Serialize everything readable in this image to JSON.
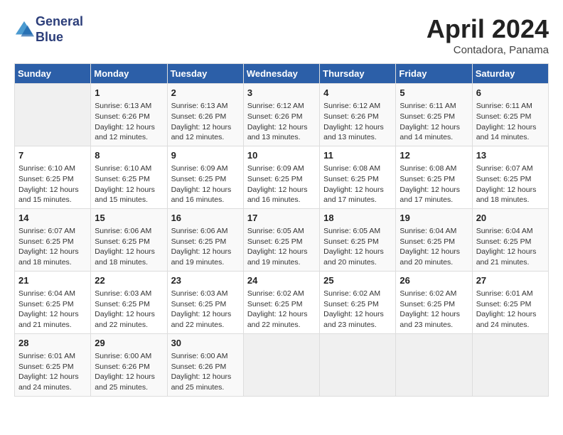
{
  "logo": {
    "line1": "General",
    "line2": "Blue"
  },
  "title": "April 2024",
  "subtitle": "Contadora, Panama",
  "days_header": [
    "Sunday",
    "Monday",
    "Tuesday",
    "Wednesday",
    "Thursday",
    "Friday",
    "Saturday"
  ],
  "weeks": [
    [
      {
        "num": "",
        "info": ""
      },
      {
        "num": "1",
        "info": "Sunrise: 6:13 AM\nSunset: 6:26 PM\nDaylight: 12 hours\nand 12 minutes."
      },
      {
        "num": "2",
        "info": "Sunrise: 6:13 AM\nSunset: 6:26 PM\nDaylight: 12 hours\nand 12 minutes."
      },
      {
        "num": "3",
        "info": "Sunrise: 6:12 AM\nSunset: 6:26 PM\nDaylight: 12 hours\nand 13 minutes."
      },
      {
        "num": "4",
        "info": "Sunrise: 6:12 AM\nSunset: 6:26 PM\nDaylight: 12 hours\nand 13 minutes."
      },
      {
        "num": "5",
        "info": "Sunrise: 6:11 AM\nSunset: 6:25 PM\nDaylight: 12 hours\nand 14 minutes."
      },
      {
        "num": "6",
        "info": "Sunrise: 6:11 AM\nSunset: 6:25 PM\nDaylight: 12 hours\nand 14 minutes."
      }
    ],
    [
      {
        "num": "7",
        "info": "Sunrise: 6:10 AM\nSunset: 6:25 PM\nDaylight: 12 hours\nand 15 minutes."
      },
      {
        "num": "8",
        "info": "Sunrise: 6:10 AM\nSunset: 6:25 PM\nDaylight: 12 hours\nand 15 minutes."
      },
      {
        "num": "9",
        "info": "Sunrise: 6:09 AM\nSunset: 6:25 PM\nDaylight: 12 hours\nand 16 minutes."
      },
      {
        "num": "10",
        "info": "Sunrise: 6:09 AM\nSunset: 6:25 PM\nDaylight: 12 hours\nand 16 minutes."
      },
      {
        "num": "11",
        "info": "Sunrise: 6:08 AM\nSunset: 6:25 PM\nDaylight: 12 hours\nand 17 minutes."
      },
      {
        "num": "12",
        "info": "Sunrise: 6:08 AM\nSunset: 6:25 PM\nDaylight: 12 hours\nand 17 minutes."
      },
      {
        "num": "13",
        "info": "Sunrise: 6:07 AM\nSunset: 6:25 PM\nDaylight: 12 hours\nand 18 minutes."
      }
    ],
    [
      {
        "num": "14",
        "info": "Sunrise: 6:07 AM\nSunset: 6:25 PM\nDaylight: 12 hours\nand 18 minutes."
      },
      {
        "num": "15",
        "info": "Sunrise: 6:06 AM\nSunset: 6:25 PM\nDaylight: 12 hours\nand 18 minutes."
      },
      {
        "num": "16",
        "info": "Sunrise: 6:06 AM\nSunset: 6:25 PM\nDaylight: 12 hours\nand 19 minutes."
      },
      {
        "num": "17",
        "info": "Sunrise: 6:05 AM\nSunset: 6:25 PM\nDaylight: 12 hours\nand 19 minutes."
      },
      {
        "num": "18",
        "info": "Sunrise: 6:05 AM\nSunset: 6:25 PM\nDaylight: 12 hours\nand 20 minutes."
      },
      {
        "num": "19",
        "info": "Sunrise: 6:04 AM\nSunset: 6:25 PM\nDaylight: 12 hours\nand 20 minutes."
      },
      {
        "num": "20",
        "info": "Sunrise: 6:04 AM\nSunset: 6:25 PM\nDaylight: 12 hours\nand 21 minutes."
      }
    ],
    [
      {
        "num": "21",
        "info": "Sunrise: 6:04 AM\nSunset: 6:25 PM\nDaylight: 12 hours\nand 21 minutes."
      },
      {
        "num": "22",
        "info": "Sunrise: 6:03 AM\nSunset: 6:25 PM\nDaylight: 12 hours\nand 22 minutes."
      },
      {
        "num": "23",
        "info": "Sunrise: 6:03 AM\nSunset: 6:25 PM\nDaylight: 12 hours\nand 22 minutes."
      },
      {
        "num": "24",
        "info": "Sunrise: 6:02 AM\nSunset: 6:25 PM\nDaylight: 12 hours\nand 22 minutes."
      },
      {
        "num": "25",
        "info": "Sunrise: 6:02 AM\nSunset: 6:25 PM\nDaylight: 12 hours\nand 23 minutes."
      },
      {
        "num": "26",
        "info": "Sunrise: 6:02 AM\nSunset: 6:25 PM\nDaylight: 12 hours\nand 23 minutes."
      },
      {
        "num": "27",
        "info": "Sunrise: 6:01 AM\nSunset: 6:25 PM\nDaylight: 12 hours\nand 24 minutes."
      }
    ],
    [
      {
        "num": "28",
        "info": "Sunrise: 6:01 AM\nSunset: 6:25 PM\nDaylight: 12 hours\nand 24 minutes."
      },
      {
        "num": "29",
        "info": "Sunrise: 6:00 AM\nSunset: 6:26 PM\nDaylight: 12 hours\nand 25 minutes."
      },
      {
        "num": "30",
        "info": "Sunrise: 6:00 AM\nSunset: 6:26 PM\nDaylight: 12 hours\nand 25 minutes."
      },
      {
        "num": "",
        "info": ""
      },
      {
        "num": "",
        "info": ""
      },
      {
        "num": "",
        "info": ""
      },
      {
        "num": "",
        "info": ""
      }
    ]
  ]
}
